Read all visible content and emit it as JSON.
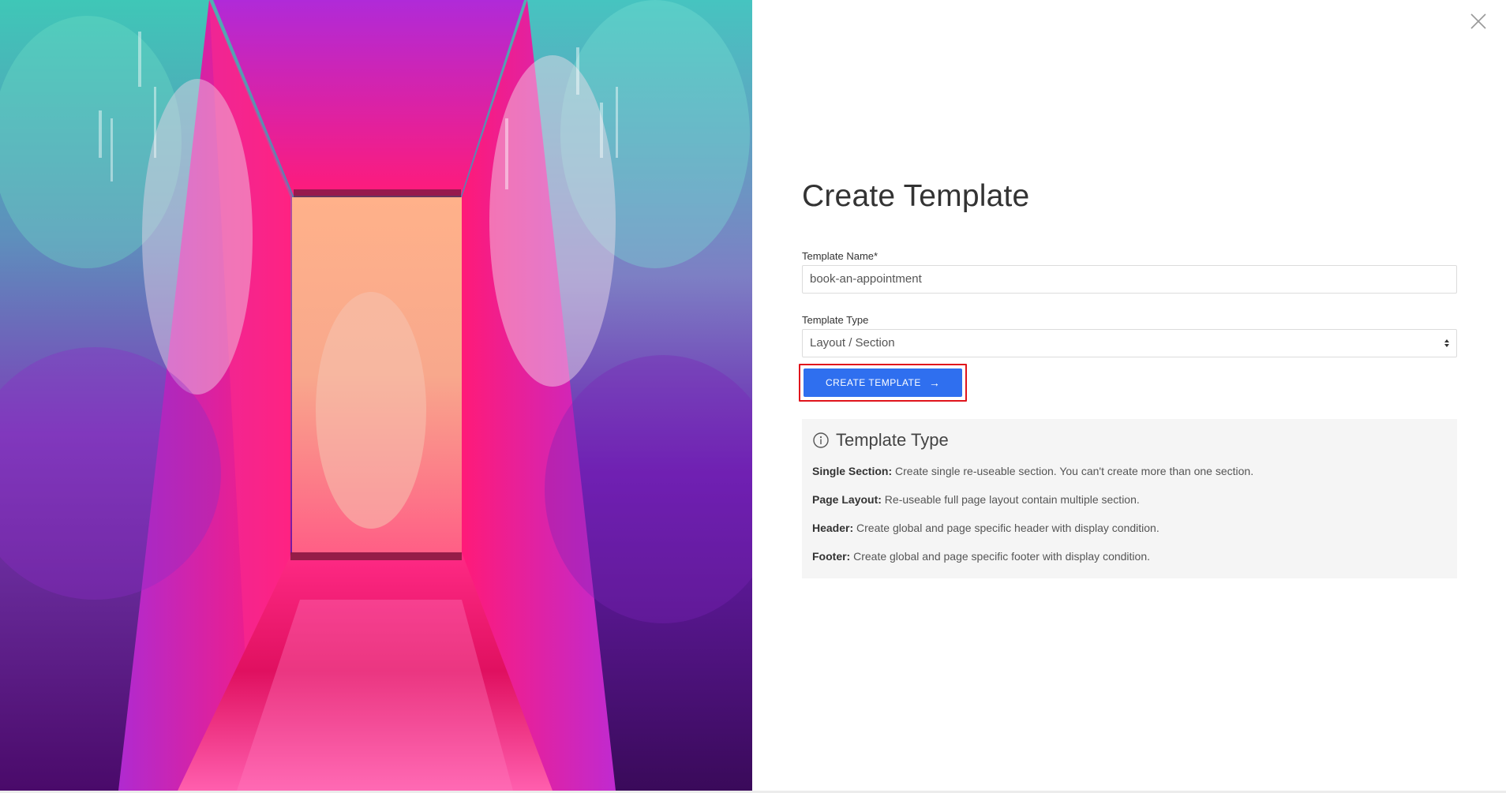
{
  "dialog": {
    "title": "Create Template",
    "close_icon": "close-icon"
  },
  "form": {
    "name_label": "Template Name*",
    "name_value": "book-an-appointment",
    "type_label": "Template Type",
    "type_value": "Layout / Section",
    "submit_label": "CREATE TEMPLATE",
    "submit_icon": "arrow-right-icon"
  },
  "info": {
    "icon": "info-icon",
    "title": "Template Type",
    "items": [
      {
        "term": "Single Section:",
        "desc": "Create single re-useable section. You can't create more than one section."
      },
      {
        "term": "Page Layout:",
        "desc": "Re-useable full page layout contain multiple section."
      },
      {
        "term": "Header:",
        "desc": "Create global and page specific header with display condition."
      },
      {
        "term": "Footer:",
        "desc": "Create global and page specific footer with display condition."
      }
    ]
  },
  "colors": {
    "primary_button": "#2f6fef",
    "highlight_border": "#e0141c",
    "info_background": "#f5f5f5"
  }
}
